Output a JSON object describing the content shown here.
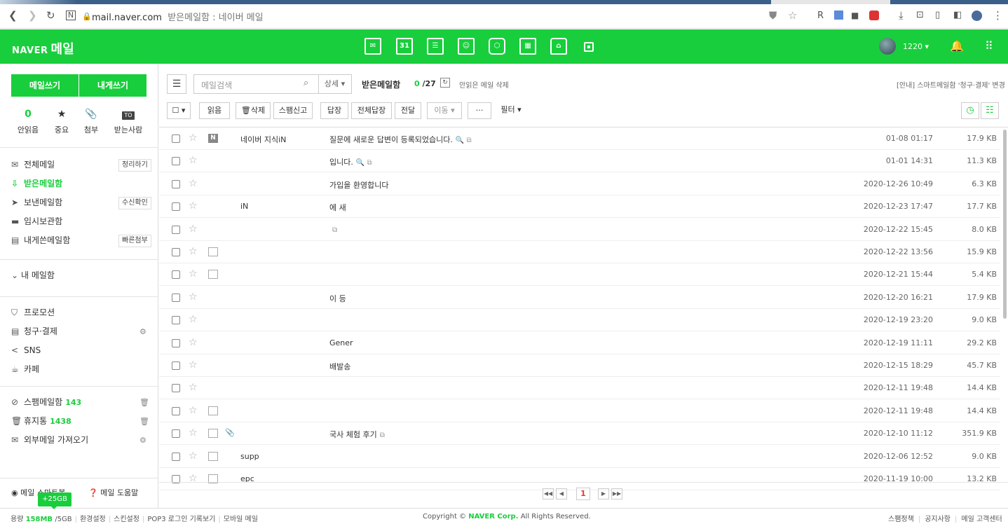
{
  "browser": {
    "url": "mail.naver.com",
    "tab_title": "받은메일함 : 네이버 메일",
    "ext_r": "R"
  },
  "app": {
    "brand": "NAVER",
    "service": "메일",
    "user": "1220",
    "calendar_day": "31"
  },
  "colors": {
    "accent": "#19ce3c",
    "page_current": "#e33333"
  },
  "sidebar": {
    "write_label": "메일쓰기",
    "write_self_label": "내게쓰기",
    "quick": [
      {
        "icon": "",
        "value": "0",
        "label": "안읽음"
      },
      {
        "icon": "★",
        "label": "중요"
      },
      {
        "icon": "📎",
        "label": "첨부"
      },
      {
        "icon": "TO",
        "label": "받는사람"
      }
    ],
    "folders": [
      {
        "icon": "✉",
        "label": "전체메일",
        "button": "정리하기"
      },
      {
        "icon": "⇩",
        "label": "받은메일함"
      },
      {
        "icon": "➤",
        "label": "보낸메일함",
        "button": "수신확인"
      },
      {
        "icon": "▬",
        "label": "임시보관함"
      },
      {
        "icon": "▤",
        "label": "내게쓴메일함",
        "button": "빠른첨부"
      }
    ],
    "my_mailbox": "내 메일함",
    "extras": [
      {
        "icon": "⛉",
        "label": "프로모션"
      },
      {
        "icon": "▤",
        "label": "청구·결제"
      },
      {
        "icon": "<",
        "label": "SNS"
      },
      {
        "icon": "☕",
        "label": "카페"
      }
    ],
    "spam": {
      "label": "스팸메일함",
      "count": "143"
    },
    "trash": {
      "label": "휴지통",
      "count": "1438"
    },
    "external": {
      "label": "외부메일 가져오기"
    },
    "smart_label": "메일 스마트봇",
    "help_label": "메일 도움말"
  },
  "toolbar": {
    "search_placeholder": "메일검색",
    "detail": "상세 ▾",
    "box_title": "받은메일함",
    "unread": "0",
    "total": "/27",
    "refresh_icon": "↻",
    "delete_unread": "안읽은 메일 삭제",
    "notice": "[안내] 스마트메일함 '청구·결제' 변경",
    "read": "읽음",
    "delete": "삭제",
    "spam": "스팸신고",
    "reply": "답장",
    "reply_all": "전체답장",
    "forward": "전달",
    "move": "이동 ▾",
    "more": "···",
    "filter": "필터 ▾"
  },
  "mails": [
    {
      "sender_icon": "N",
      "icon_type": "n",
      "attach": "",
      "sender": "네이버 지식iN",
      "subject": "질문에 새로운 답변이 등록되었습니다.",
      "ext": "🔍 ⧉",
      "date": "01-08 01:17",
      "size": "17.9 KB"
    },
    {
      "sender_icon": "",
      "icon_type": "",
      "attach": "",
      "sender": "",
      "subject": "입니다.",
      "ext": "🔍 ⧉",
      "date": "01-01 14:31",
      "size": "11.3 KB"
    },
    {
      "sender_icon": "",
      "icon_type": "",
      "attach": "",
      "sender": "",
      "subject": "가입을 환영합니다",
      "ext": "",
      "date": "2020-12-26 10:49",
      "size": "6.3 KB"
    },
    {
      "sender_icon": "",
      "icon_type": "",
      "attach": "",
      "sender": "iN",
      "subject": "에 새",
      "ext": "",
      "date": "2020-12-23 17:47",
      "size": "17.7 KB"
    },
    {
      "sender_icon": "",
      "icon_type": "",
      "attach": "",
      "sender": "",
      "subject": "",
      "ext": "⧉",
      "date": "2020-12-22 15:45",
      "size": "8.0 KB"
    },
    {
      "sender_icon": "",
      "icon_type": "e",
      "attach": "",
      "sender": "",
      "subject": "",
      "ext": "",
      "date": "2020-12-22 13:56",
      "size": "15.9 KB"
    },
    {
      "sender_icon": "",
      "icon_type": "e",
      "attach": "",
      "sender": "",
      "subject": "",
      "ext": "",
      "date": "2020-12-21 15:44",
      "size": "5.4 KB"
    },
    {
      "sender_icon": "",
      "icon_type": "",
      "attach": "",
      "sender": "",
      "subject": "이 등",
      "ext": "",
      "date": "2020-12-20 16:21",
      "size": "17.9 KB"
    },
    {
      "sender_icon": "",
      "icon_type": "",
      "attach": "",
      "sender": "",
      "subject": "",
      "ext": "",
      "date": "2020-12-19 23:20",
      "size": "9.0 KB"
    },
    {
      "sender_icon": "",
      "icon_type": "",
      "attach": "",
      "sender": "",
      "subject": "Gener",
      "ext": "",
      "date": "2020-12-19 11:11",
      "size": "29.2 KB"
    },
    {
      "sender_icon": "",
      "icon_type": "",
      "attach": "",
      "sender": "",
      "subject": "배발송",
      "ext": "",
      "date": "2020-12-15 18:29",
      "size": "45.7 KB"
    },
    {
      "sender_icon": "",
      "icon_type": "",
      "attach": "",
      "sender": "",
      "subject": "",
      "ext": "",
      "date": "2020-12-11 19:48",
      "size": "14.4 KB"
    },
    {
      "sender_icon": "",
      "icon_type": "e",
      "attach": "",
      "sender": "",
      "subject": "",
      "ext": "",
      "date": "2020-12-11 19:48",
      "size": "14.4 KB"
    },
    {
      "sender_icon": "",
      "icon_type": "e",
      "attach": "📎",
      "sender": "",
      "subject": "국사 체험 후기",
      "ext": "⧉",
      "date": "2020-12-10 11:12",
      "size": "351.9 KB"
    },
    {
      "sender_icon": "",
      "icon_type": "e",
      "attach": "",
      "sender": "supp",
      "subject": "",
      "ext": "",
      "date": "2020-12-06 12:52",
      "size": "9.0 KB"
    },
    {
      "sender_icon": "",
      "icon_type": "e",
      "attach": "",
      "sender": "epc",
      "subject": "",
      "ext": "",
      "date": "2020-11-19 10:00",
      "size": "13.2 KB"
    }
  ],
  "pager": {
    "current": "1",
    "first": "◀◀",
    "prev": "◀",
    "next": "▶",
    "last": "▶▶"
  },
  "footer": {
    "quota_label": "용량",
    "used": "158MB",
    "total": "/5GB",
    "links": [
      "환경설정",
      "스킨설정",
      "POP3 로그인 기록보기",
      "모바일 메일"
    ],
    "badge": "+25GB",
    "copyright_pre": "Copyright ©",
    "corp": "NAVER Corp.",
    "copyright_post": "All Rights Reserved.",
    "right_links": [
      "스팸정책",
      "공지사항",
      "메일 고객센터"
    ]
  }
}
